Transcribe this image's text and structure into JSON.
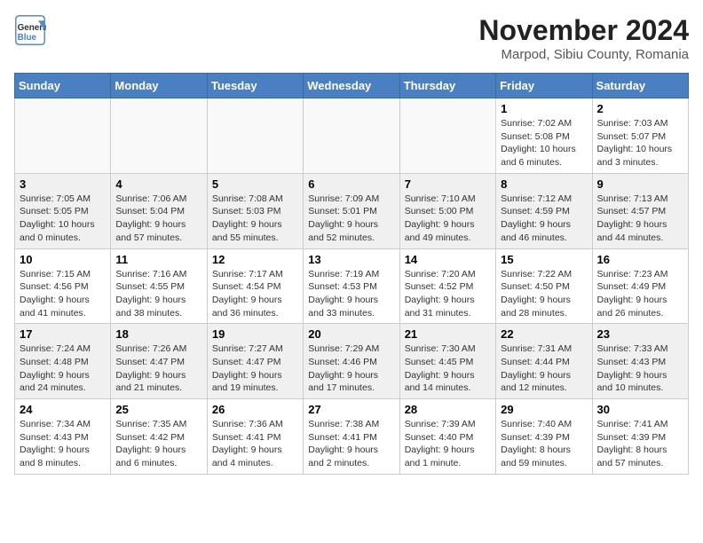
{
  "header": {
    "logo_line1": "General",
    "logo_line2": "Blue",
    "month_title": "November 2024",
    "location": "Marpod, Sibiu County, Romania"
  },
  "weekdays": [
    "Sunday",
    "Monday",
    "Tuesday",
    "Wednesday",
    "Thursday",
    "Friday",
    "Saturday"
  ],
  "weeks": [
    [
      {
        "day": "",
        "info": ""
      },
      {
        "day": "",
        "info": ""
      },
      {
        "day": "",
        "info": ""
      },
      {
        "day": "",
        "info": ""
      },
      {
        "day": "",
        "info": ""
      },
      {
        "day": "1",
        "info": "Sunrise: 7:02 AM\nSunset: 5:08 PM\nDaylight: 10 hours and 6 minutes."
      },
      {
        "day": "2",
        "info": "Sunrise: 7:03 AM\nSunset: 5:07 PM\nDaylight: 10 hours and 3 minutes."
      }
    ],
    [
      {
        "day": "3",
        "info": "Sunrise: 7:05 AM\nSunset: 5:05 PM\nDaylight: 10 hours and 0 minutes."
      },
      {
        "day": "4",
        "info": "Sunrise: 7:06 AM\nSunset: 5:04 PM\nDaylight: 9 hours and 57 minutes."
      },
      {
        "day": "5",
        "info": "Sunrise: 7:08 AM\nSunset: 5:03 PM\nDaylight: 9 hours and 55 minutes."
      },
      {
        "day": "6",
        "info": "Sunrise: 7:09 AM\nSunset: 5:01 PM\nDaylight: 9 hours and 52 minutes."
      },
      {
        "day": "7",
        "info": "Sunrise: 7:10 AM\nSunset: 5:00 PM\nDaylight: 9 hours and 49 minutes."
      },
      {
        "day": "8",
        "info": "Sunrise: 7:12 AM\nSunset: 4:59 PM\nDaylight: 9 hours and 46 minutes."
      },
      {
        "day": "9",
        "info": "Sunrise: 7:13 AM\nSunset: 4:57 PM\nDaylight: 9 hours and 44 minutes."
      }
    ],
    [
      {
        "day": "10",
        "info": "Sunrise: 7:15 AM\nSunset: 4:56 PM\nDaylight: 9 hours and 41 minutes."
      },
      {
        "day": "11",
        "info": "Sunrise: 7:16 AM\nSunset: 4:55 PM\nDaylight: 9 hours and 38 minutes."
      },
      {
        "day": "12",
        "info": "Sunrise: 7:17 AM\nSunset: 4:54 PM\nDaylight: 9 hours and 36 minutes."
      },
      {
        "day": "13",
        "info": "Sunrise: 7:19 AM\nSunset: 4:53 PM\nDaylight: 9 hours and 33 minutes."
      },
      {
        "day": "14",
        "info": "Sunrise: 7:20 AM\nSunset: 4:52 PM\nDaylight: 9 hours and 31 minutes."
      },
      {
        "day": "15",
        "info": "Sunrise: 7:22 AM\nSunset: 4:50 PM\nDaylight: 9 hours and 28 minutes."
      },
      {
        "day": "16",
        "info": "Sunrise: 7:23 AM\nSunset: 4:49 PM\nDaylight: 9 hours and 26 minutes."
      }
    ],
    [
      {
        "day": "17",
        "info": "Sunrise: 7:24 AM\nSunset: 4:48 PM\nDaylight: 9 hours and 24 minutes."
      },
      {
        "day": "18",
        "info": "Sunrise: 7:26 AM\nSunset: 4:47 PM\nDaylight: 9 hours and 21 minutes."
      },
      {
        "day": "19",
        "info": "Sunrise: 7:27 AM\nSunset: 4:47 PM\nDaylight: 9 hours and 19 minutes."
      },
      {
        "day": "20",
        "info": "Sunrise: 7:29 AM\nSunset: 4:46 PM\nDaylight: 9 hours and 17 minutes."
      },
      {
        "day": "21",
        "info": "Sunrise: 7:30 AM\nSunset: 4:45 PM\nDaylight: 9 hours and 14 minutes."
      },
      {
        "day": "22",
        "info": "Sunrise: 7:31 AM\nSunset: 4:44 PM\nDaylight: 9 hours and 12 minutes."
      },
      {
        "day": "23",
        "info": "Sunrise: 7:33 AM\nSunset: 4:43 PM\nDaylight: 9 hours and 10 minutes."
      }
    ],
    [
      {
        "day": "24",
        "info": "Sunrise: 7:34 AM\nSunset: 4:43 PM\nDaylight: 9 hours and 8 minutes."
      },
      {
        "day": "25",
        "info": "Sunrise: 7:35 AM\nSunset: 4:42 PM\nDaylight: 9 hours and 6 minutes."
      },
      {
        "day": "26",
        "info": "Sunrise: 7:36 AM\nSunset: 4:41 PM\nDaylight: 9 hours and 4 minutes."
      },
      {
        "day": "27",
        "info": "Sunrise: 7:38 AM\nSunset: 4:41 PM\nDaylight: 9 hours and 2 minutes."
      },
      {
        "day": "28",
        "info": "Sunrise: 7:39 AM\nSunset: 4:40 PM\nDaylight: 9 hours and 1 minute."
      },
      {
        "day": "29",
        "info": "Sunrise: 7:40 AM\nSunset: 4:39 PM\nDaylight: 8 hours and 59 minutes."
      },
      {
        "day": "30",
        "info": "Sunrise: 7:41 AM\nSunset: 4:39 PM\nDaylight: 8 hours and 57 minutes."
      }
    ]
  ]
}
